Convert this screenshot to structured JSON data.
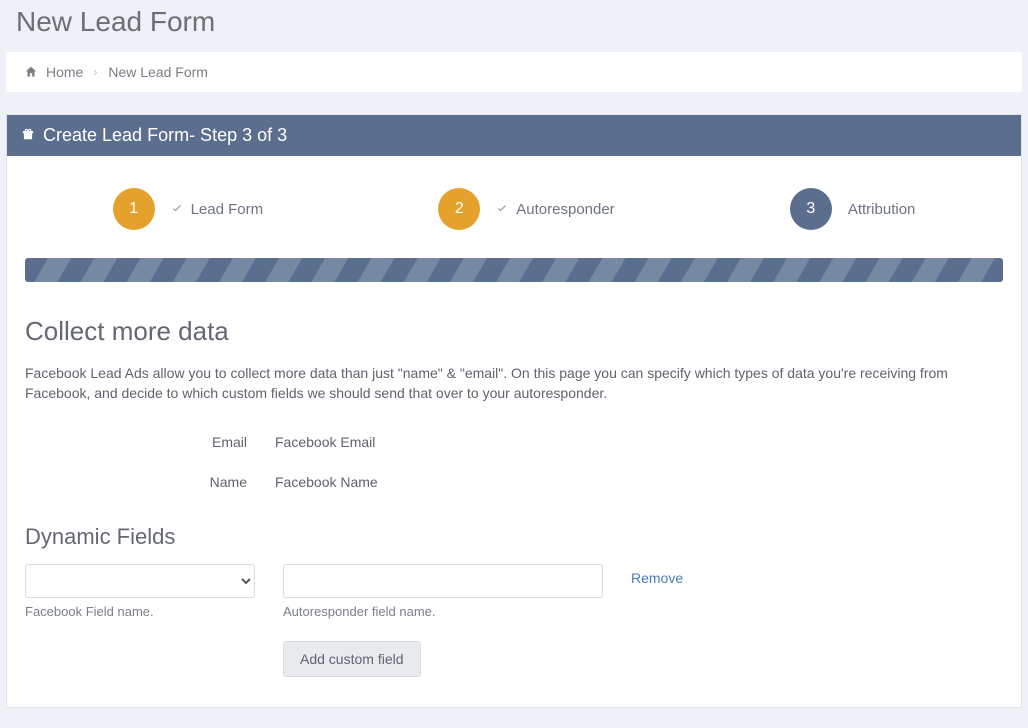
{
  "page": {
    "title": "New Lead Form"
  },
  "breadcrumb": {
    "home": "Home",
    "current": "New Lead Form"
  },
  "panel": {
    "title": "Create Lead Form- Step 3 of 3"
  },
  "steps": {
    "s1": {
      "num": "1",
      "label": "Lead Form"
    },
    "s2": {
      "num": "2",
      "label": "Autoresponder"
    },
    "s3": {
      "num": "3",
      "label": "Attribution"
    }
  },
  "collect": {
    "title": "Collect more data",
    "desc": "Facebook Lead Ads allow you to collect more data than just \"name\" & \"email\". On this page you can specify which types of data you're receiving from Facebook, and decide to which custom fields we should send that over to your autoresponder.",
    "email_label": "Email",
    "email_value": "Facebook Email",
    "name_label": "Name",
    "name_value": "Facebook Name"
  },
  "dynamic": {
    "title": "Dynamic Fields",
    "select_help": "Facebook Field name.",
    "input_help": "Autoresponder field name.",
    "remove": "Remove",
    "add_btn": "Add custom field"
  }
}
